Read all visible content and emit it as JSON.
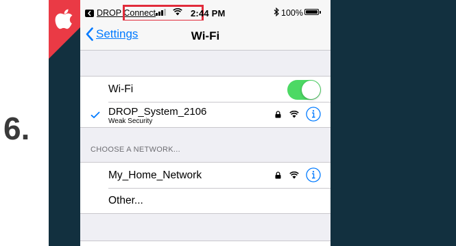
{
  "step": {
    "number": "6."
  },
  "colors": {
    "frame_bg": "#12303f",
    "badge_red": "#ea3a45",
    "highlight_red": "#e12b3a",
    "ios_blue": "#007aff",
    "toggle_on": "#4cd964"
  },
  "status_bar": {
    "back_app_label": "DROP Connect",
    "time": "2:44 PM",
    "battery": "100%",
    "icons": [
      "back-to-app-icon",
      "signal-bars-icon",
      "wifi-icon",
      "bluetooth-icon",
      "battery-icon"
    ]
  },
  "nav": {
    "back_label": "Settings",
    "title": "Wi-Fi"
  },
  "wifi_toggle": {
    "label": "Wi-Fi",
    "on": true
  },
  "connected_network": {
    "name": "DROP_System_2106",
    "subtitle": "Weak Security",
    "icons": [
      "checkmark-icon",
      "lock-icon",
      "wifi-icon",
      "info-icon"
    ]
  },
  "choose_section": {
    "header": "CHOOSE A NETWORK...",
    "networks": [
      {
        "name": "My_Home_Network",
        "icons": [
          "lock-icon",
          "wifi-icon",
          "info-icon"
        ]
      },
      {
        "name": "Other..."
      }
    ]
  }
}
